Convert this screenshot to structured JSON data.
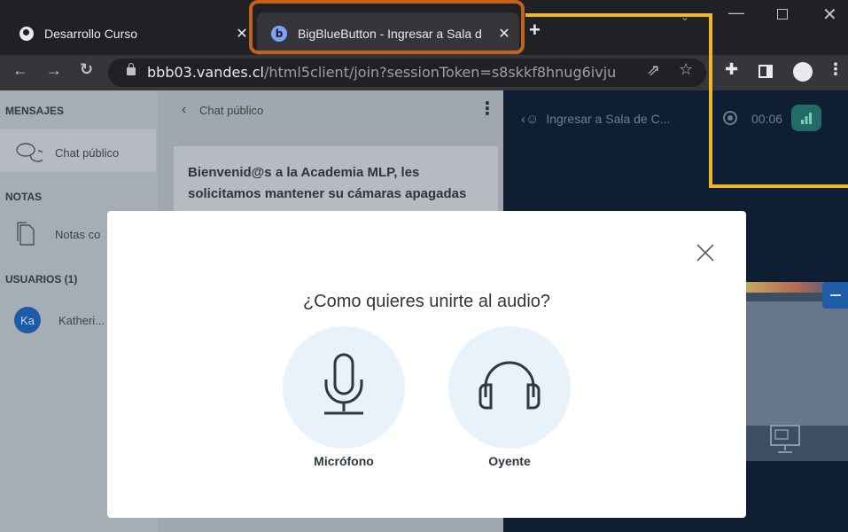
{
  "browser": {
    "tabs": [
      {
        "title": "Desarrollo Curso",
        "close": "✕"
      },
      {
        "title": "BigBlueButton - Ingresar a Sala d",
        "close": "✕",
        "favicon_letter": "b"
      }
    ],
    "new_tab": "+",
    "url_host": "bbb03.vandes.cl",
    "url_path": "/html5client/join?sessionToken=s8skkf8hnug6ivju"
  },
  "sidebar": {
    "messages_header": "MENSAJES",
    "public_chat": "Chat público",
    "notes_header": "NOTAS",
    "shared_notes": "Notas co",
    "users_header": "USUARIOS (1)",
    "user_initials": "Ka",
    "user_name": "Katheri..."
  },
  "chat": {
    "header_title": "Chat público",
    "welcome_message": "Bienvenid@s a la Academia MLP, les solicitamos mantener su cámaras apagadas"
  },
  "room": {
    "title": "Ingresar a Sala de C...",
    "recording_time": "00:06"
  },
  "modal": {
    "title": "¿Como quieres unirte al audio?",
    "microphone_label": "Micrófono",
    "listen_only_label": "Oyente"
  },
  "colors": {
    "tab_highlight": "#c5611c",
    "callout_line": "#f2b624",
    "modal_bg": "#ffffff",
    "option_circle": "#e8f2fb",
    "user_avatar": "#1f5ca8"
  }
}
